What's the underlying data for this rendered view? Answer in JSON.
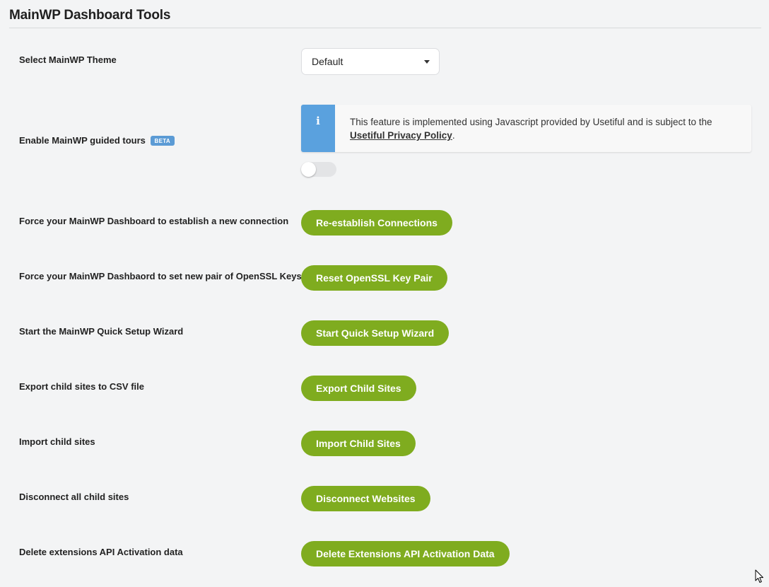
{
  "page": {
    "title": "MainWP Dashboard Tools"
  },
  "theme": {
    "label": "Select MainWP Theme",
    "selected": "Default"
  },
  "tours": {
    "label": "Enable MainWP guided tours",
    "badge": "BETA",
    "info_text": "This feature is implemented using Javascript provided by Usetiful and is subject to the",
    "info_link": "Usetiful Privacy Policy",
    "info_end": ".",
    "toggle_enabled": false
  },
  "rows": [
    {
      "label": "Force your MainWP Dashboard to establish a new connection",
      "button": "Re-establish Connections"
    },
    {
      "label": "Force your MainWP Dashbaord to set new pair of OpenSSL Keys",
      "button": "Reset OpenSSL Key Pair"
    },
    {
      "label": "Start the MainWP Quick Setup Wizard",
      "button": "Start Quick Setup Wizard"
    },
    {
      "label": "Export child sites to CSV file",
      "button": "Export Child Sites"
    },
    {
      "label": "Import child sites",
      "button": "Import Child Sites"
    },
    {
      "label": "Disconnect all child sites",
      "button": "Disconnect Websites"
    },
    {
      "label": "Delete extensions API Activation data",
      "button": "Delete Extensions API Activation Data"
    }
  ],
  "colors": {
    "button": "#7fac1f",
    "info_accent": "#5aa1de",
    "beta_badge": "#5b9bd5",
    "background": "#f3f4f5"
  },
  "icons": {
    "info": "info-icon",
    "dropdown": "chevron-down-icon",
    "cursor": "mouse-pointer-icon"
  }
}
